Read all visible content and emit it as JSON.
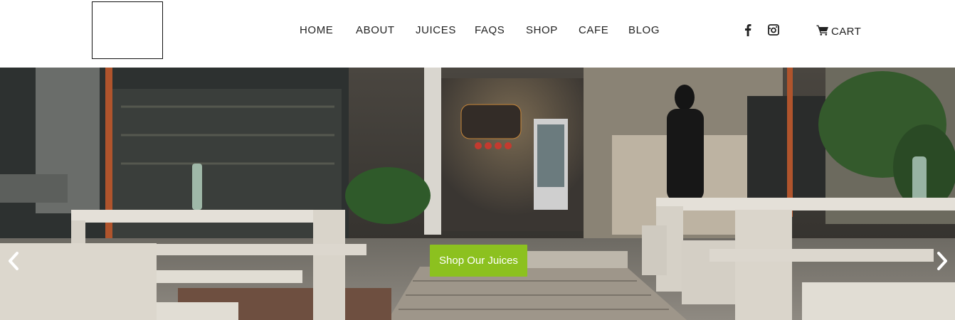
{
  "header": {
    "logo": "site-logo",
    "nav": [
      {
        "label": "HOME"
      },
      {
        "label": "ABOUT"
      },
      {
        "label": "JUICES"
      },
      {
        "label": "FAQS"
      },
      {
        "label": "SHOP"
      },
      {
        "label": "CAFE"
      },
      {
        "label": "BLOG"
      }
    ],
    "social": [
      {
        "icon": "facebook-icon"
      },
      {
        "icon": "instagram-icon"
      }
    ],
    "cart": {
      "icon": "cart-icon",
      "label": "CART"
    }
  },
  "hero": {
    "image": "cafe-interior-photo",
    "cta_label": "Shop Our Juices",
    "cta_color": "#8cc11f",
    "prev_icon": "chevron-left-icon",
    "next_icon": "chevron-right-icon"
  }
}
